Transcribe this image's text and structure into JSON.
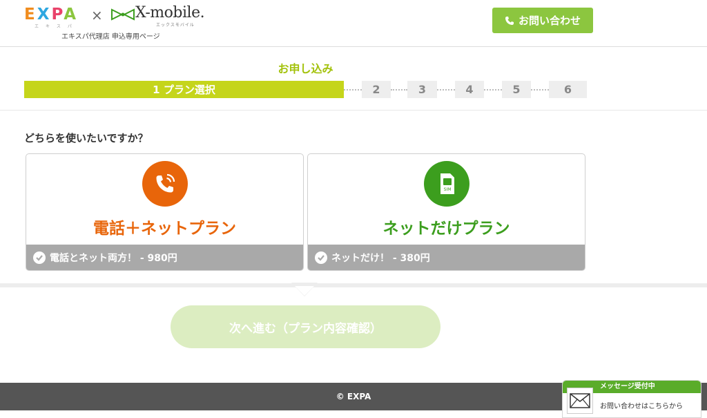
{
  "header": {
    "expa_letters": [
      "E",
      "X",
      "P",
      "A"
    ],
    "expa_kana": "エキスパ",
    "times": "×",
    "xmobile": "X-mobile.",
    "xmobile_kana": "エックスモバイル",
    "agent_note": "エキスパ代理店 申込専用ページ",
    "contact_label": "お問い合わせ"
  },
  "steps": {
    "title": "お申し込み",
    "active_label": "1 プラン選択",
    "items": [
      "2",
      "3",
      "4",
      "5",
      "6"
    ]
  },
  "question": "どちらを使いたいですか？",
  "plans": [
    {
      "name": "電話＋ネットプラン",
      "footer": "電話とネット両方！ - 980円",
      "icon": "phone-call-icon",
      "color": "#e8650a"
    },
    {
      "name": "ネットだけプラン",
      "footer": "ネットだけ！ - 380円",
      "icon": "sim-card-icon",
      "color": "#3c9e1e"
    }
  ],
  "next_button": "次へ進む（プラン内容確認）",
  "footer": {
    "copyright": "© EXPA"
  },
  "chat": {
    "title": "メッセージ受付中",
    "body": "お問い合わせはこちらから"
  }
}
